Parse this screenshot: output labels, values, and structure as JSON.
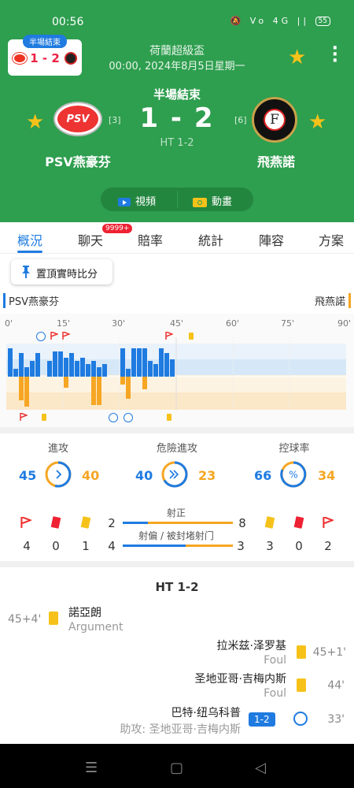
{
  "statusbar": {
    "time": "00:56",
    "icons": "🔕 Vo 4G ||",
    "battery": "55"
  },
  "mini": {
    "tag": "半場結束",
    "score": "1 - 2"
  },
  "header": {
    "league": "荷蘭超級盃",
    "date": "00:00, 2024年8月5日星期一",
    "status": "半場結束",
    "score": "1 - 2",
    "ht": "HT 1-2",
    "home": {
      "name": "PSV燕豪芬",
      "rank": "[3]",
      "logo_text": "PSV"
    },
    "away": {
      "name": "飛燕諾",
      "rank": "[6]",
      "logo_text": "F"
    },
    "video_label": "視頻",
    "anim_label": "動畫",
    "colors": {
      "green": "#2e9e4f",
      "star": "#f6c21a"
    }
  },
  "tabs": [
    {
      "label": "概況"
    },
    {
      "label": "聊天"
    },
    {
      "label": "賠率"
    },
    {
      "label": "統計"
    },
    {
      "label": "陣容"
    },
    {
      "label": "方案"
    }
  ],
  "chat_badge": "9999+",
  "pin_label": "置頂實時比分",
  "timeline": {
    "home": "PSV燕豪芬",
    "away": "飛燕諾",
    "minutes": [
      "0'",
      "15'",
      "30'",
      "45'",
      "60'",
      "75'",
      "90'"
    ],
    "home_pressure": [
      36,
      10,
      30,
      12,
      20,
      30,
      20,
      32,
      32,
      24,
      30,
      20,
      24,
      16,
      20,
      12,
      16,
      36,
      10,
      36,
      36,
      36,
      20,
      16,
      36,
      30,
      22
    ],
    "away_pressure": [
      0,
      0,
      30,
      38,
      0,
      0,
      0,
      0,
      0,
      14,
      0,
      0,
      0,
      0,
      36,
      36,
      0,
      10,
      28,
      0,
      0,
      16,
      0,
      0,
      0,
      0,
      0
    ]
  },
  "stats": {
    "attack": {
      "label": "進攻",
      "home": "45",
      "away": "40"
    },
    "danger": {
      "label": "危險進攻",
      "home": "40",
      "away": "23"
    },
    "possession": {
      "label": "控球率",
      "home": "66",
      "away": "34"
    }
  },
  "counts": {
    "home": {
      "corners": "4",
      "red": "0",
      "yellow": "1"
    },
    "away": {
      "yellow": "3",
      "red": "0",
      "corners": "2"
    }
  },
  "shots": {
    "on_label": "射正",
    "on_home": "2",
    "on_away": "8",
    "off_label": "射偏 / 被封堵射门",
    "off_home": "4",
    "off_away": "3"
  },
  "events_title": "HT 1-2",
  "events": [
    {
      "min": "45+4'",
      "name": "諾亞朗",
      "sub": "Argument"
    },
    {
      "min": "45+1'",
      "name": "拉米兹·泽罗基",
      "sub": "Foul"
    },
    {
      "min": "44'",
      "name": "圣地亚哥·吉梅内斯",
      "sub": "Foul"
    },
    {
      "min": "33'",
      "name": "巴特·纽乌科普",
      "sub": "助攻: 圣地亚哥·吉梅内斯",
      "score": "1-2"
    }
  ],
  "nav": {
    "menu": "☰",
    "home": "▢",
    "back": "◁"
  }
}
